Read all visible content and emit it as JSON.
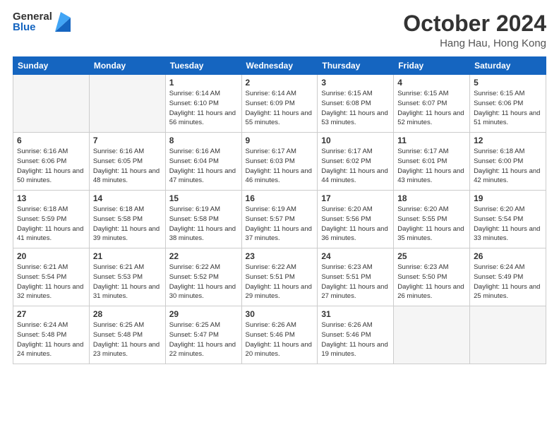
{
  "header": {
    "logo_general": "General",
    "logo_blue": "Blue",
    "month_title": "October 2024",
    "location": "Hang Hau, Hong Kong"
  },
  "weekdays": [
    "Sunday",
    "Monday",
    "Tuesday",
    "Wednesday",
    "Thursday",
    "Friday",
    "Saturday"
  ],
  "weeks": [
    [
      {
        "day": "",
        "sunrise": "",
        "sunset": "",
        "daylight": ""
      },
      {
        "day": "",
        "sunrise": "",
        "sunset": "",
        "daylight": ""
      },
      {
        "day": "1",
        "sunrise": "Sunrise: 6:14 AM",
        "sunset": "Sunset: 6:10 PM",
        "daylight": "Daylight: 11 hours and 56 minutes."
      },
      {
        "day": "2",
        "sunrise": "Sunrise: 6:14 AM",
        "sunset": "Sunset: 6:09 PM",
        "daylight": "Daylight: 11 hours and 55 minutes."
      },
      {
        "day": "3",
        "sunrise": "Sunrise: 6:15 AM",
        "sunset": "Sunset: 6:08 PM",
        "daylight": "Daylight: 11 hours and 53 minutes."
      },
      {
        "day": "4",
        "sunrise": "Sunrise: 6:15 AM",
        "sunset": "Sunset: 6:07 PM",
        "daylight": "Daylight: 11 hours and 52 minutes."
      },
      {
        "day": "5",
        "sunrise": "Sunrise: 6:15 AM",
        "sunset": "Sunset: 6:06 PM",
        "daylight": "Daylight: 11 hours and 51 minutes."
      }
    ],
    [
      {
        "day": "6",
        "sunrise": "Sunrise: 6:16 AM",
        "sunset": "Sunset: 6:06 PM",
        "daylight": "Daylight: 11 hours and 50 minutes."
      },
      {
        "day": "7",
        "sunrise": "Sunrise: 6:16 AM",
        "sunset": "Sunset: 6:05 PM",
        "daylight": "Daylight: 11 hours and 48 minutes."
      },
      {
        "day": "8",
        "sunrise": "Sunrise: 6:16 AM",
        "sunset": "Sunset: 6:04 PM",
        "daylight": "Daylight: 11 hours and 47 minutes."
      },
      {
        "day": "9",
        "sunrise": "Sunrise: 6:17 AM",
        "sunset": "Sunset: 6:03 PM",
        "daylight": "Daylight: 11 hours and 46 minutes."
      },
      {
        "day": "10",
        "sunrise": "Sunrise: 6:17 AM",
        "sunset": "Sunset: 6:02 PM",
        "daylight": "Daylight: 11 hours and 44 minutes."
      },
      {
        "day": "11",
        "sunrise": "Sunrise: 6:17 AM",
        "sunset": "Sunset: 6:01 PM",
        "daylight": "Daylight: 11 hours and 43 minutes."
      },
      {
        "day": "12",
        "sunrise": "Sunrise: 6:18 AM",
        "sunset": "Sunset: 6:00 PM",
        "daylight": "Daylight: 11 hours and 42 minutes."
      }
    ],
    [
      {
        "day": "13",
        "sunrise": "Sunrise: 6:18 AM",
        "sunset": "Sunset: 5:59 PM",
        "daylight": "Daylight: 11 hours and 41 minutes."
      },
      {
        "day": "14",
        "sunrise": "Sunrise: 6:18 AM",
        "sunset": "Sunset: 5:58 PM",
        "daylight": "Daylight: 11 hours and 39 minutes."
      },
      {
        "day": "15",
        "sunrise": "Sunrise: 6:19 AM",
        "sunset": "Sunset: 5:58 PM",
        "daylight": "Daylight: 11 hours and 38 minutes."
      },
      {
        "day": "16",
        "sunrise": "Sunrise: 6:19 AM",
        "sunset": "Sunset: 5:57 PM",
        "daylight": "Daylight: 11 hours and 37 minutes."
      },
      {
        "day": "17",
        "sunrise": "Sunrise: 6:20 AM",
        "sunset": "Sunset: 5:56 PM",
        "daylight": "Daylight: 11 hours and 36 minutes."
      },
      {
        "day": "18",
        "sunrise": "Sunrise: 6:20 AM",
        "sunset": "Sunset: 5:55 PM",
        "daylight": "Daylight: 11 hours and 35 minutes."
      },
      {
        "day": "19",
        "sunrise": "Sunrise: 6:20 AM",
        "sunset": "Sunset: 5:54 PM",
        "daylight": "Daylight: 11 hours and 33 minutes."
      }
    ],
    [
      {
        "day": "20",
        "sunrise": "Sunrise: 6:21 AM",
        "sunset": "Sunset: 5:54 PM",
        "daylight": "Daylight: 11 hours and 32 minutes."
      },
      {
        "day": "21",
        "sunrise": "Sunrise: 6:21 AM",
        "sunset": "Sunset: 5:53 PM",
        "daylight": "Daylight: 11 hours and 31 minutes."
      },
      {
        "day": "22",
        "sunrise": "Sunrise: 6:22 AM",
        "sunset": "Sunset: 5:52 PM",
        "daylight": "Daylight: 11 hours and 30 minutes."
      },
      {
        "day": "23",
        "sunrise": "Sunrise: 6:22 AM",
        "sunset": "Sunset: 5:51 PM",
        "daylight": "Daylight: 11 hours and 29 minutes."
      },
      {
        "day": "24",
        "sunrise": "Sunrise: 6:23 AM",
        "sunset": "Sunset: 5:51 PM",
        "daylight": "Daylight: 11 hours and 27 minutes."
      },
      {
        "day": "25",
        "sunrise": "Sunrise: 6:23 AM",
        "sunset": "Sunset: 5:50 PM",
        "daylight": "Daylight: 11 hours and 26 minutes."
      },
      {
        "day": "26",
        "sunrise": "Sunrise: 6:24 AM",
        "sunset": "Sunset: 5:49 PM",
        "daylight": "Daylight: 11 hours and 25 minutes."
      }
    ],
    [
      {
        "day": "27",
        "sunrise": "Sunrise: 6:24 AM",
        "sunset": "Sunset: 5:48 PM",
        "daylight": "Daylight: 11 hours and 24 minutes."
      },
      {
        "day": "28",
        "sunrise": "Sunrise: 6:25 AM",
        "sunset": "Sunset: 5:48 PM",
        "daylight": "Daylight: 11 hours and 23 minutes."
      },
      {
        "day": "29",
        "sunrise": "Sunrise: 6:25 AM",
        "sunset": "Sunset: 5:47 PM",
        "daylight": "Daylight: 11 hours and 22 minutes."
      },
      {
        "day": "30",
        "sunrise": "Sunrise: 6:26 AM",
        "sunset": "Sunset: 5:46 PM",
        "daylight": "Daylight: 11 hours and 20 minutes."
      },
      {
        "day": "31",
        "sunrise": "Sunrise: 6:26 AM",
        "sunset": "Sunset: 5:46 PM",
        "daylight": "Daylight: 11 hours and 19 minutes."
      },
      {
        "day": "",
        "sunrise": "",
        "sunset": "",
        "daylight": ""
      },
      {
        "day": "",
        "sunrise": "",
        "sunset": "",
        "daylight": ""
      }
    ]
  ]
}
